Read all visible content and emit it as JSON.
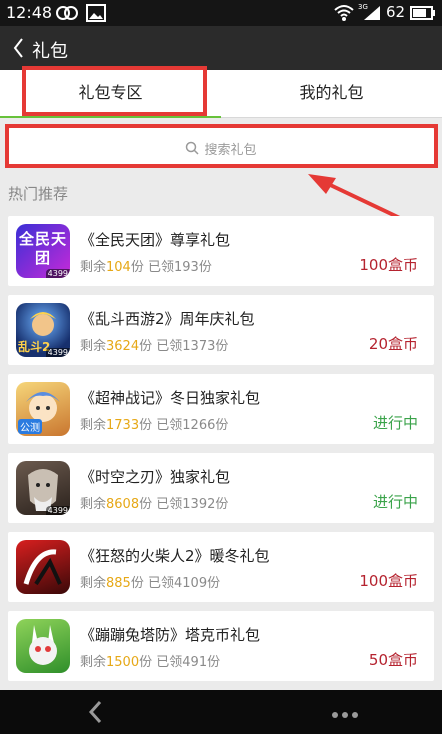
{
  "status": {
    "time": "12:48",
    "battery": "62",
    "signal_label": "3G"
  },
  "header": {
    "title": "礼包"
  },
  "tabs": [
    {
      "label": "礼包专区",
      "active": true
    },
    {
      "label": "我的礼包",
      "active": false
    }
  ],
  "search": {
    "placeholder": "搜索礼包"
  },
  "section": {
    "title": "热门推荐"
  },
  "labels": {
    "remain_prefix": "剩余",
    "remain_unit": "份",
    "claimed_prefix": "已领",
    "claimed_unit": "份"
  },
  "gifts": [
    {
      "name": "《全民天团》尊享礼包",
      "remaining": "104",
      "claimed": "193",
      "price": "100盒币",
      "status": "price",
      "icon_text": "全民天团",
      "badge": "4399"
    },
    {
      "name": "《乱斗西游2》周年庆礼包",
      "remaining": "3624",
      "claimed": "1373",
      "price": "20盒币",
      "status": "price",
      "icon_text": "乱斗2",
      "badge": "4399"
    },
    {
      "name": "《超神战记》冬日独家礼包",
      "remaining": "1733",
      "claimed": "1266",
      "price": "进行中",
      "status": "ongoing",
      "icon_text": "公测",
      "badge": ""
    },
    {
      "name": "《时空之刃》独家礼包",
      "remaining": "8608",
      "claimed": "1392",
      "price": "进行中",
      "status": "ongoing",
      "icon_text": "",
      "badge": "4399"
    },
    {
      "name": "《狂怒的火柴人2》暖冬礼包",
      "remaining": "885",
      "claimed": "4109",
      "price": "100盒币",
      "status": "price",
      "icon_text": "",
      "badge": ""
    },
    {
      "name": "《蹦蹦兔塔防》塔克币礼包",
      "remaining": "1500",
      "claimed": "491",
      "price": "50盒币",
      "status": "price",
      "icon_text": "",
      "badge": ""
    }
  ],
  "colors": {
    "accent_green": "#67c23a",
    "highlight_red": "#e53935",
    "price_red": "#b5232f",
    "ongoing_green": "#3aa34a",
    "remain_orange": "#e6a817"
  },
  "icons": {
    "back": "chevron-left-icon",
    "search": "search-icon",
    "nav_back": "nav-back-icon",
    "nav_more": "more-dots-icon"
  }
}
